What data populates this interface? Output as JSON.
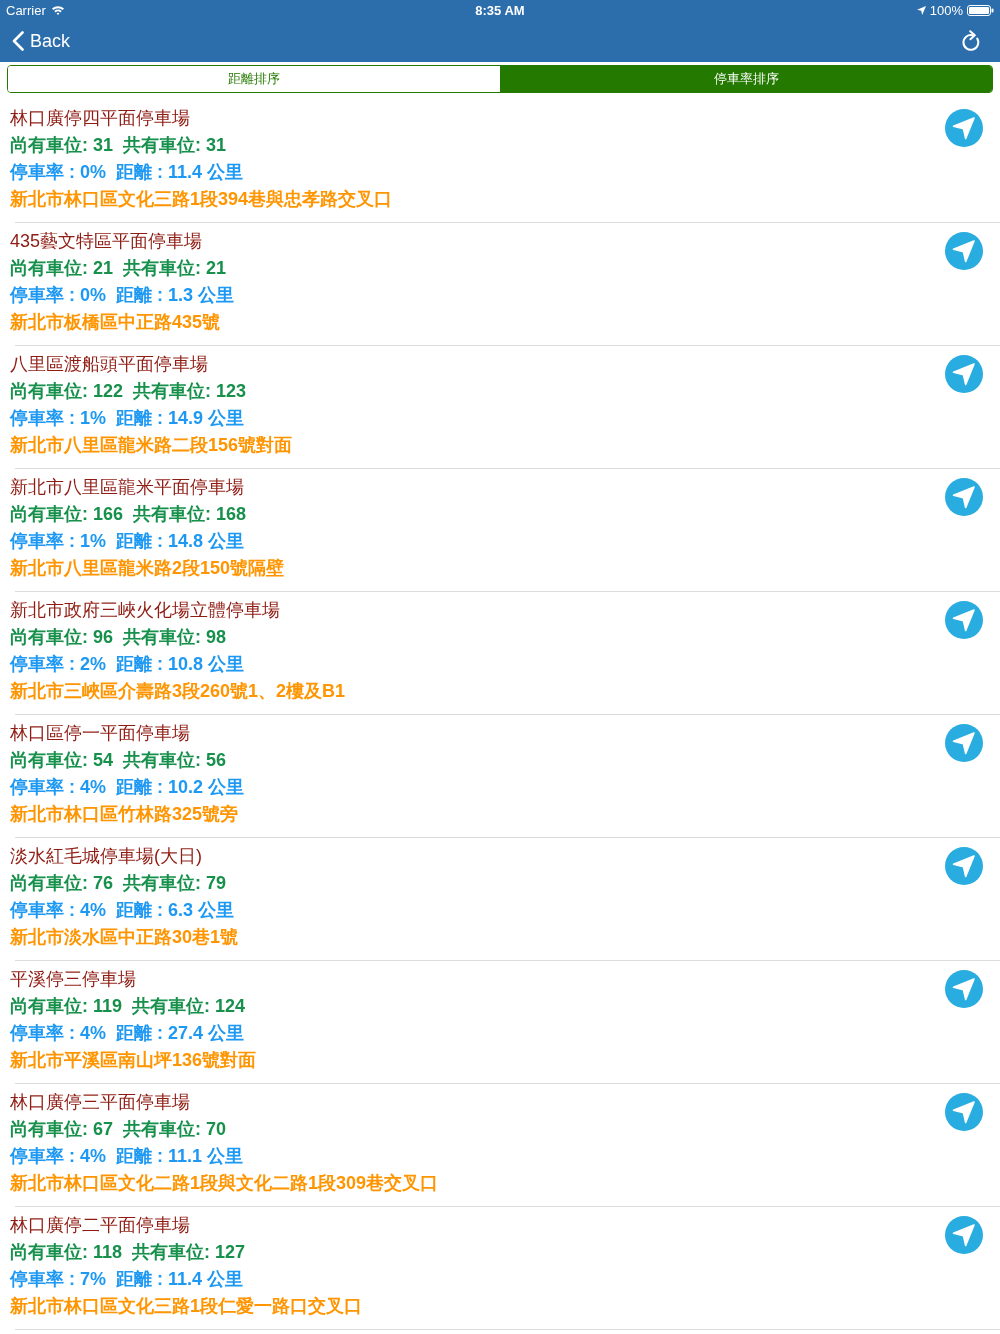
{
  "status_bar": {
    "carrier": "Carrier",
    "time": "8:35 AM",
    "battery": "100%"
  },
  "nav_bar": {
    "back": "Back"
  },
  "sort_tabs": [
    {
      "label": "距離排序",
      "selected": false
    },
    {
      "label": "停車率排序",
      "selected": true
    }
  ],
  "lots": [
    {
      "name": "林口廣停四平面停車場",
      "spaces": "尚有車位: 31  共有車位: 31",
      "rate_distance": "停車率 : 0%  距離 : 11.4 公里",
      "address": "新北市林口區文化三路1段394巷與忠孝路交叉口"
    },
    {
      "name": "435藝文特區平面停車場",
      "spaces": "尚有車位: 21  共有車位: 21",
      "rate_distance": "停車率 : 0%  距離 : 1.3 公里",
      "address": "新北市板橋區中正路435號"
    },
    {
      "name": "八里區渡船頭平面停車場",
      "spaces": "尚有車位: 122  共有車位: 123",
      "rate_distance": "停車率 : 1%  距離 : 14.9 公里",
      "address": "新北市八里區龍米路二段156號對面"
    },
    {
      "name": "新北市八里區龍米平面停車場",
      "spaces": "尚有車位: 166  共有車位: 168",
      "rate_distance": "停車率 : 1%  距離 : 14.8 公里",
      "address": "新北市八里區龍米路2段150號隔壁"
    },
    {
      "name": "新北市政府三峽火化場立體停車場",
      "spaces": "尚有車位: 96  共有車位: 98",
      "rate_distance": "停車率 : 2%  距離 : 10.8 公里",
      "address": "新北市三峽區介壽路3段260號1、2樓及B1"
    },
    {
      "name": "林口區停一平面停車場",
      "spaces": "尚有車位: 54  共有車位: 56",
      "rate_distance": "停車率 : 4%  距離 : 10.2 公里",
      "address": "新北市林口區竹林路325號旁"
    },
    {
      "name": "淡水紅毛城停車場(大日)",
      "spaces": "尚有車位: 76  共有車位: 79",
      "rate_distance": "停車率 : 4%  距離 : 6.3 公里",
      "address": "新北市淡水區中正路30巷1號"
    },
    {
      "name": "平溪停三停車場",
      "spaces": "尚有車位: 119  共有車位: 124",
      "rate_distance": "停車率 : 4%  距離 : 27.4 公里",
      "address": "新北市平溪區南山坪136號對面"
    },
    {
      "name": "林口廣停三平面停車場",
      "spaces": "尚有車位: 67  共有車位: 70",
      "rate_distance": "停車率 : 4%  距離 : 11.1 公里",
      "address": "新北市林口區文化二路1段與文化二路1段309巷交叉口"
    },
    {
      "name": "林口廣停二平面停車場",
      "spaces": "尚有車位: 118  共有車位: 127",
      "rate_distance": "停車率 : 7%  距離 : 11.4 公里",
      "address": "新北市林口區文化三路1段仁愛一路口交叉口"
    }
  ]
}
